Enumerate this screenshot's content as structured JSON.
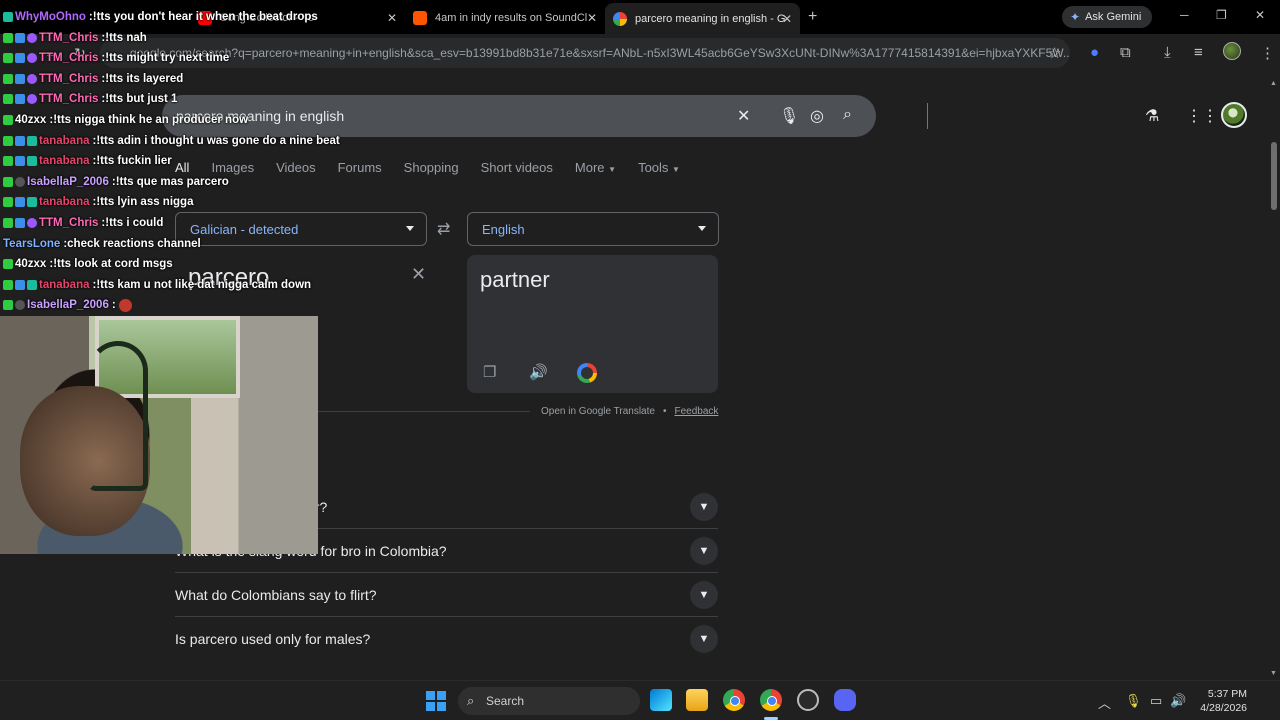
{
  "browser": {
    "tabs": [
      {
        "title": "Song Collector - Yo",
        "favicon_color": "#ff0000"
      },
      {
        "title": "4am in indy results on SoundCl",
        "favicon_color": "#ff5500"
      },
      {
        "title": "parcero meaning in english - G",
        "favicon_color": "#ffffff"
      }
    ],
    "new_tab": "+",
    "ask_gemini": "Ask Gemini",
    "url": "google.com/search?q=parcero+meaning+in+english&sca_esv=b13991bd8b31e71e&sxsrf=ANbL-n5xI3WL45acb6GeYSw3XcUNt-DINw%3A1777415814391&ei=hjbxaYXKF5W..."
  },
  "google": {
    "query": "parcero meaning in english",
    "filters": [
      "All",
      "Images",
      "Videos",
      "Forums",
      "Shopping",
      "Short videos",
      "More",
      "Tools"
    ],
    "translate": {
      "source_lang": "Galician - detected",
      "target_lang": "English",
      "source_text": "parcero",
      "target_text": "partner",
      "open_link": "Open in Google Translate",
      "feedback": "Feedback",
      "separator": "•"
    },
    "paa": [
      "What is the slang word for bro in Colombia?",
      "What do Colombians say to flirt?",
      "Is parcero used only for males?"
    ],
    "paa_partial": "or?"
  },
  "chat": [
    {
      "user": "WhyMoOhno",
      "color": "#b266ff",
      "msg": "!tts you don't hear it when the beat drops",
      "badges": [
        "teal"
      ]
    },
    {
      "user": "TTM_Chris",
      "color": "#ff69b4",
      "msg": "!tts nah",
      "badges": [
        "green",
        "blue",
        "purple"
      ]
    },
    {
      "user": "TTM_Chris",
      "color": "#ff69b4",
      "msg": "!tts might try next time",
      "badges": [
        "green",
        "blue",
        "purple"
      ]
    },
    {
      "user": "TTM_Chris",
      "color": "#ff69b4",
      "msg": "!tts its layered",
      "badges": [
        "green",
        "blue",
        "purple"
      ]
    },
    {
      "user": "TTM_Chris",
      "color": "#ff69b4",
      "msg": "!tts but just 1",
      "badges": [
        "green",
        "blue",
        "purple"
      ]
    },
    {
      "user": "40zxx",
      "color": "#ffffff",
      "msg": "!tts nigga think he an producer now",
      "badges": [
        "green"
      ]
    },
    {
      "user": "tanabana",
      "color": "#e8446b",
      "msg": "!tts adin i thought u was gone do a nine beat",
      "badges": [
        "green",
        "blue",
        "teal"
      ]
    },
    {
      "user": "tanabana",
      "color": "#e8446b",
      "msg": "!tts fuckin lier",
      "badges": [
        "green",
        "blue",
        "teal"
      ]
    },
    {
      "user": "IsabellaP_2006",
      "color": "#c9a0ff",
      "msg": "!tts que mas parcero",
      "badges": [
        "green",
        "gray"
      ]
    },
    {
      "user": "tanabana",
      "color": "#e8446b",
      "msg": "!tts lyin ass nigga",
      "badges": [
        "green",
        "blue",
        "teal"
      ]
    },
    {
      "user": "TTM_Chris",
      "color": "#ff69b4",
      "msg": "!tts i could",
      "badges": [
        "green",
        "blue",
        "purple"
      ]
    },
    {
      "user": "TearsLone",
      "color": "#7fb2ff",
      "msg": "check reactions channel",
      "badges": []
    },
    {
      "user": "40zxx",
      "color": "#ffffff",
      "msg": "!tts look at cord msgs",
      "badges": [
        "green"
      ]
    },
    {
      "user": "tanabana",
      "color": "#e8446b",
      "msg": "!tts kam u not like dat nigga calm down",
      "badges": [
        "green",
        "blue",
        "teal"
      ]
    },
    {
      "user": "IsabellaP_2006",
      "color": "#c9a0ff",
      "msg": "",
      "badges": [
        "green",
        "gray"
      ],
      "emote": true
    }
  ],
  "taskbar": {
    "search_label": "Search",
    "time": "5:37 PM",
    "date": "4/28/2026"
  }
}
